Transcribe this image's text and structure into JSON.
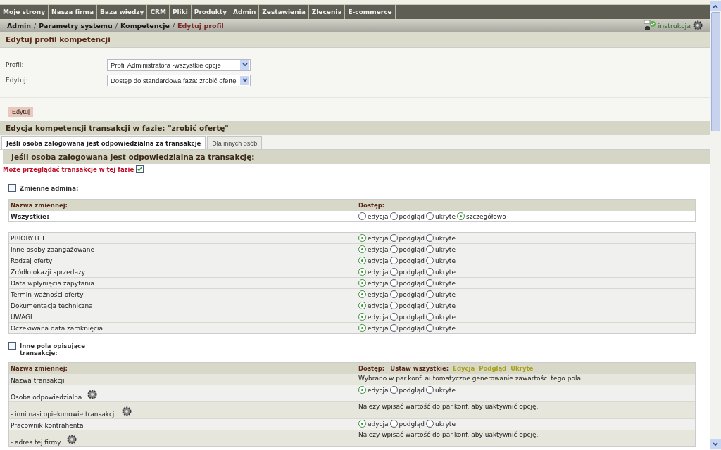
{
  "nav": [
    "Moje strony",
    "Nasza firma",
    "Baza wiedzy",
    "CRM",
    "Pliki",
    "Produkty",
    "Admin",
    "Zestawienia",
    "Zlecenia",
    "E-commerce"
  ],
  "breadcrumb": [
    {
      "label": "Admin",
      "current": false
    },
    {
      "label": "Parametry systemu",
      "current": false
    },
    {
      "label": "Kompetencje",
      "current": false
    },
    {
      "label": "Edytuj profil",
      "current": true
    }
  ],
  "breadcrumb_separator": "/",
  "help_link": "instrukcja",
  "page_title": "Edytuj profil kompetencji",
  "form": [
    {
      "label": "Profil:",
      "value": "Profil Administratora -wszystkie opcje"
    },
    {
      "label": "Edytuj:",
      "value": "Dostęp do standardowa faza: zrobić ofertę"
    }
  ],
  "edit_button": "Edytuj",
  "section_title": "Edycja kompetencji transakcji w fazie: \"zrobić ofertę\"",
  "tabs": [
    {
      "label": "Jeśli osoba zalogowana jest odpowiedzialna za transakcje",
      "selected": true
    },
    {
      "label": "Dla innych osób",
      "selected": false
    }
  ],
  "subheading": "Jeśli osoba zalogowana jest odpowiedzialna za transakcję:",
  "can_view": {
    "label": "Może przeglądać transakcje w tej fazie",
    "checked": true
  },
  "admin_vars": {
    "label": "Zmienne admina:",
    "checked": false,
    "header": {
      "name": "Nazwa zmiennej:",
      "access": "Dostęp:"
    },
    "all_row": {
      "name": "Wszystkie:",
      "options": [
        {
          "label": "edycja",
          "selected": false
        },
        {
          "label": "podgląd",
          "selected": false
        },
        {
          "label": "ukryte",
          "selected": false
        },
        {
          "label": "szczegółowo",
          "selected": true
        }
      ]
    }
  },
  "variables": [
    {
      "name": "PRIORYTET",
      "options": [
        {
          "label": "edycja",
          "selected": true
        },
        {
          "label": "podgląd",
          "selected": false
        },
        {
          "label": "ukryte",
          "selected": false
        }
      ]
    },
    {
      "name": "Inne osoby zaangażowane",
      "options": [
        {
          "label": "edycja",
          "selected": true
        },
        {
          "label": "podgląd",
          "selected": false
        },
        {
          "label": "ukryte",
          "selected": false
        }
      ]
    },
    {
      "name": "Rodzaj oferty",
      "options": [
        {
          "label": "edycja",
          "selected": true
        },
        {
          "label": "podgląd",
          "selected": false
        },
        {
          "label": "ukryte",
          "selected": false
        }
      ]
    },
    {
      "name": "Źródło okazji sprzedaży",
      "options": [
        {
          "label": "edycja",
          "selected": true
        },
        {
          "label": "podgląd",
          "selected": false
        },
        {
          "label": "ukryte",
          "selected": false
        }
      ]
    },
    {
      "name": "Data wpłynięcia zapytania",
      "options": [
        {
          "label": "edycja",
          "selected": true
        },
        {
          "label": "podgląd",
          "selected": false
        },
        {
          "label": "ukryte",
          "selected": false
        }
      ]
    },
    {
      "name": "Termin ważności oferty",
      "options": [
        {
          "label": "edycja",
          "selected": true
        },
        {
          "label": "podgląd",
          "selected": false
        },
        {
          "label": "ukryte",
          "selected": false
        }
      ]
    },
    {
      "name": "Dokumentacja techniczna",
      "options": [
        {
          "label": "edycja",
          "selected": true
        },
        {
          "label": "podgląd",
          "selected": false
        },
        {
          "label": "ukryte",
          "selected": false
        }
      ]
    },
    {
      "name": "UWAGI",
      "options": [
        {
          "label": "edycja",
          "selected": true
        },
        {
          "label": "podgląd",
          "selected": false
        },
        {
          "label": "ukryte",
          "selected": false
        }
      ]
    },
    {
      "name": "Oczekiwana data zamknięcia",
      "options": [
        {
          "label": "edycja",
          "selected": true
        },
        {
          "label": "podgląd",
          "selected": false
        },
        {
          "label": "ukryte",
          "selected": false
        }
      ]
    }
  ],
  "other_fields": {
    "label": "Inne pola opisujące transakcję:",
    "checked": false,
    "header": {
      "name": "Nazwa zmiennej:",
      "access": "Dostęp:",
      "set_all": "Ustaw wszystkie:",
      "set_all_links": [
        "Edycja",
        "Podgląd",
        "Ukryte"
      ]
    },
    "rows": [
      {
        "name": "Nazwa transakcji",
        "gear": false,
        "kind": "note",
        "note": "Wybrano w par.konf. automatyczne generowanie zawartości tego pola."
      },
      {
        "name": "Osoba odpowiedzialna",
        "gear": true,
        "kind": "radio",
        "options": [
          {
            "label": "edycja",
            "selected": true
          },
          {
            "label": "podgląd",
            "selected": false
          },
          {
            "label": "ukryte",
            "selected": false
          }
        ]
      },
      {
        "name": "- inni nasi opiekunowie transakcji",
        "gear": true,
        "kind": "note",
        "note": "Należy wpisać wartość do par.konf. aby uaktywnić opcję."
      },
      {
        "name": "Pracownik kontrahenta",
        "gear": false,
        "kind": "radio",
        "options": [
          {
            "label": "edycja",
            "selected": true
          },
          {
            "label": "podgląd",
            "selected": false
          },
          {
            "label": "ukryte",
            "selected": false
          }
        ]
      },
      {
        "name": "- adres tej firmy",
        "gear": true,
        "kind": "note",
        "note": "Należy wpisać wartość do par.konf. aby uaktywnić opcję."
      }
    ]
  }
}
